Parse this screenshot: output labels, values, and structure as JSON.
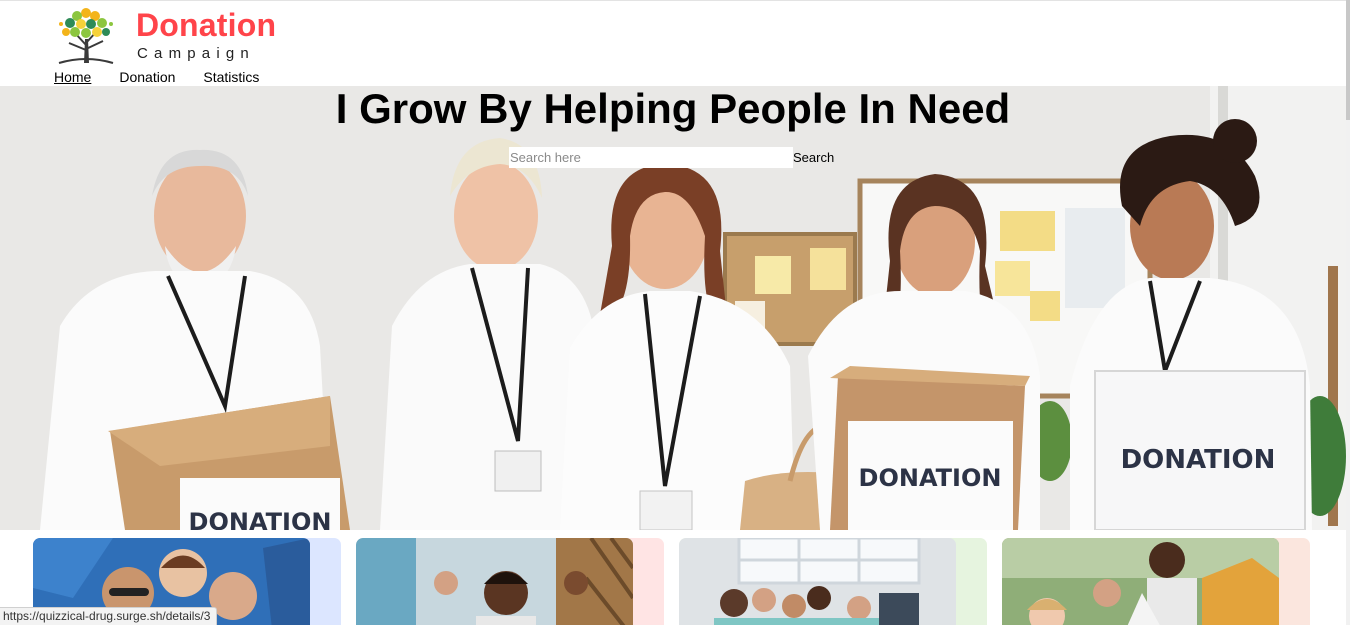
{
  "brand": {
    "title": "Donation",
    "subtitle": "Campaign"
  },
  "nav": {
    "items": [
      {
        "label": "Home"
      },
      {
        "label": "Donation"
      },
      {
        "label": "Statistics"
      }
    ]
  },
  "hero": {
    "title": "I Grow By Helping People In Need",
    "search_placeholder": "Search here",
    "search_button": "Search",
    "box_labels": [
      "DONATION",
      "DONATION",
      "DONATION"
    ]
  },
  "colors": {
    "brand_red": "#ff444a",
    "card_blue": "#dce6ff",
    "card_red": "#ffe4e4",
    "card_green": "#e6f4df",
    "card_orange": "#fbe6de"
  },
  "status_bar": {
    "url": "https://quizzical-drug.surge.sh/details/3"
  }
}
